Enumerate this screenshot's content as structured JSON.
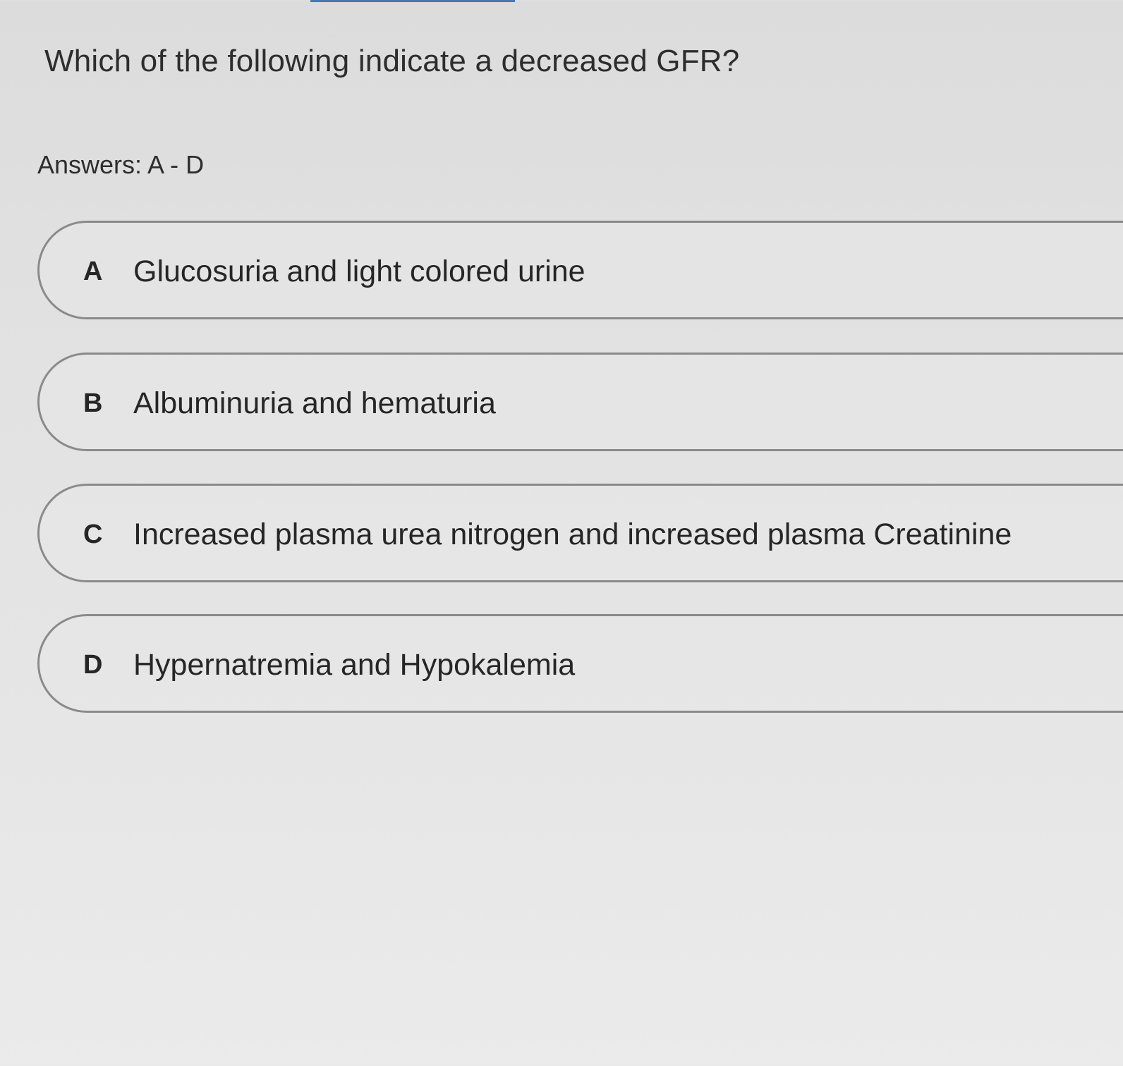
{
  "question": "Which of the following indicate a decreased GFR?",
  "answers_label": "Answers: A - D",
  "options": [
    {
      "letter": "A",
      "text": "Glucosuria and light colored urine"
    },
    {
      "letter": "B",
      "text": "Albuminuria and hematuria"
    },
    {
      "letter": "C",
      "text": "Increased plasma urea nitrogen and increased plasma Creatinine"
    },
    {
      "letter": "D",
      "text": "Hypernatremia and Hypokalemia"
    }
  ],
  "colors": {
    "background": "#e2e2e2",
    "border": "#8a8a8a",
    "text": "#2b2b2b",
    "accent": "#4a78b0"
  }
}
